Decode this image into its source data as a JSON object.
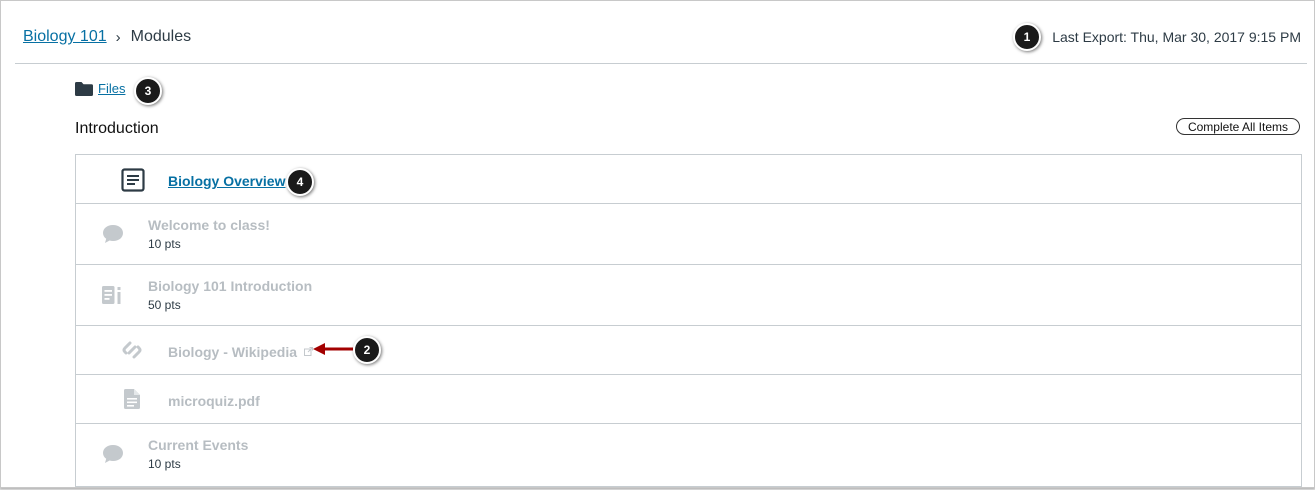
{
  "breadcrumb": {
    "course": "Biology 101",
    "separator": "›",
    "current": "Modules"
  },
  "export": {
    "text": "Last Export: Thu, Mar 30, 2017 9:15 PM"
  },
  "files": {
    "label": "Files"
  },
  "module": {
    "title": "Introduction",
    "complete_button": "Complete All Items"
  },
  "items": [
    {
      "title": "Biology Overview",
      "icon": "page-icon",
      "points": ""
    },
    {
      "title": "Welcome to class!",
      "icon": "discussion-icon",
      "points": "10 pts"
    },
    {
      "title": "Biology 101 Introduction",
      "icon": "assignment-icon",
      "points": "50 pts"
    },
    {
      "title": "Biology - Wikipedia",
      "icon": "link-icon",
      "points": ""
    },
    {
      "title": "microquiz.pdf",
      "icon": "document-icon",
      "points": ""
    },
    {
      "title": "Current Events",
      "icon": "discussion-icon",
      "points": "10 pts"
    }
  ],
  "callouts": [
    "1",
    "2",
    "3",
    "4"
  ],
  "colors": {
    "link": "#0770a3",
    "disabled": "#b7bdc2",
    "text": "#2d3b45",
    "arrow": "#a30000"
  }
}
